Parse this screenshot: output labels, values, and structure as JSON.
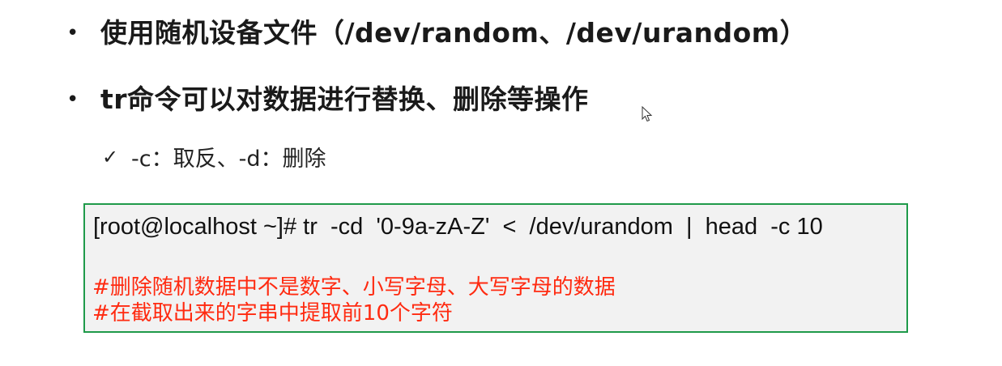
{
  "slide": {
    "bullets": [
      {
        "marker": "•",
        "text": "使用随机设备文件（/dev/random、/dev/urandom）"
      },
      {
        "marker": "•",
        "text": "tr命令可以对数据进行替换、删除等操作"
      }
    ],
    "sub_item": {
      "marker": "✓",
      "text": "-c：取反、-d：删除"
    },
    "code_box": {
      "command": "[root@localhost ~]# tr  -cd  '0-9a-zA-Z'  <  /dev/urandom  |  head  -c 10",
      "comments": [
        "#删除随机数据中不是数字、小写字母、大写字母的数据",
        "#在截取出来的字串中提取前10个字符"
      ]
    }
  },
  "colors": {
    "comment": "#ff2a10",
    "box_border": "#1f9a4a",
    "box_background": "#f2f2f2"
  },
  "icons": {
    "cursor": "mouse-pointer-icon",
    "check": "check-icon"
  }
}
